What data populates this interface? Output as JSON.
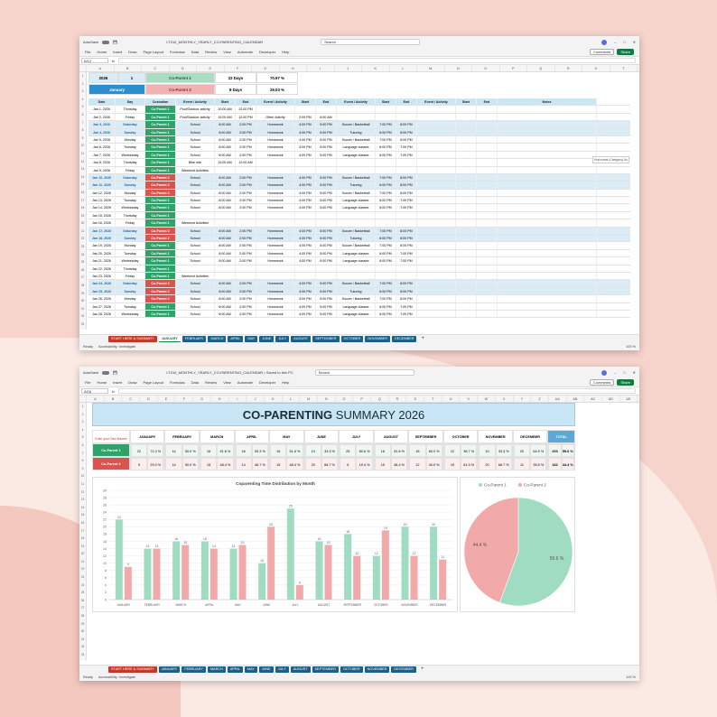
{
  "app": {
    "autosave": "AutoSave",
    "autosave_state": "Off",
    "file1": "LT010_MONTHLY_YEARLY_CO-PARENTING_CALENDAR",
    "file2": "LT010_MONTHLY_YEARLY_CO-PARENTING_CALENDAR • Saved to this PC",
    "search": "Search",
    "comments": "Comments",
    "share": "Share",
    "namebox1": "W12",
    "namebox2": "AG6",
    "fx": "fx",
    "ready": "Ready",
    "accessibility": "Accessibility: Investigate",
    "zoom": "100 %"
  },
  "ribbon": [
    "File",
    "Home",
    "Insert",
    "Draw",
    "Page Layout",
    "Formulas",
    "Data",
    "Review",
    "View",
    "Automate",
    "Developer",
    "Help"
  ],
  "columns1": [
    "A",
    "B",
    "C",
    "D",
    "E",
    "F",
    "G",
    "H",
    "I",
    "J",
    "K",
    "L",
    "M",
    "N",
    "O",
    "P",
    "Q",
    "R",
    "S",
    "T"
  ],
  "columns2": [
    "A",
    "B",
    "C",
    "D",
    "E",
    "F",
    "G",
    "H",
    "I",
    "J",
    "K",
    "L",
    "M",
    "N",
    "O",
    "P",
    "Q",
    "R",
    "S",
    "T",
    "U",
    "V",
    "W",
    "X",
    "Y",
    "Z",
    "AA",
    "AB",
    "AC",
    "AD",
    "AE"
  ],
  "tabs": [
    "START HERE & SUMMARY",
    "JANUARY",
    "FEBRUARY",
    "MARCH",
    "APRIL",
    "MAY",
    "JUNE",
    "JULY",
    "AUGUST",
    "SEPTEMBER",
    "OCTOBER",
    "NOVEMBER",
    "DECEMBER",
    "+"
  ],
  "calendar": {
    "year": "2026",
    "month_num": "1",
    "month": "January",
    "p1": "Co-Parent 1",
    "p2": "Co-Parent 2",
    "p1_days": "22 Days",
    "p1_pct": "70.97 %",
    "p2_days": "9 Days",
    "p2_pct": "29.03 %",
    "headers": [
      "Date",
      "Day",
      "Custodian",
      "Event / Activity",
      "Start",
      "End",
      "Event / Activity",
      "Start",
      "End",
      "Event / Activity",
      "Start",
      "End",
      "Event / Activity",
      "Start",
      "End",
      "Notes"
    ],
    "side_note": "Horizontal (Category) Ax",
    "rows": [
      [
        "Jan 1, 2026",
        "Thursday",
        "Co-Parent 1",
        "Pool/Outdoor activity",
        "10:00 AM",
        "12:00 PM",
        "",
        "",
        "",
        "",
        "",
        "",
        "",
        "",
        "",
        ""
      ],
      [
        "Jan 2, 2026",
        "Friday",
        "Co-Parent 1",
        "Pool/Outdoor activity",
        "10:00 AM",
        "12:00 PM",
        "Other Activity",
        "2:00 PM",
        "6:00 AM",
        "",
        "",
        "",
        "",
        "",
        "",
        ""
      ],
      [
        "Jan 3, 2026",
        "Saturday",
        "Co-Parent 1",
        "School",
        "8:00 AM",
        "2:00 PM",
        "Homework",
        "4:00 PM",
        "5:00 PM",
        "Soccer / Basketball",
        "7:00 PM",
        "8:00 PM",
        "",
        "",
        "",
        ""
      ],
      [
        "Jan 4, 2026",
        "Sunday",
        "Co-Parent 1",
        "School",
        "8:00 AM",
        "2:00 PM",
        "Homework",
        "4:00 PM",
        "5:00 PM",
        "Tutoring",
        "6:00 PM",
        "8:00 PM",
        "",
        "",
        "",
        ""
      ],
      [
        "Jan 5, 2026",
        "Monday",
        "Co-Parent 1",
        "School",
        "8:00 AM",
        "2:00 PM",
        "Homework",
        "4:00 PM",
        "5:00 PM",
        "Soccer / Basketball",
        "7:00 PM",
        "8:00 PM",
        "",
        "",
        "",
        ""
      ],
      [
        "Jan 6, 2026",
        "Tuesday",
        "Co-Parent 1",
        "School",
        "8:00 AM",
        "2:00 PM",
        "Homework",
        "4:00 PM",
        "5:00 PM",
        "Language classes",
        "6:00 PM",
        "7:00 PM",
        "",
        "",
        "",
        ""
      ],
      [
        "Jan 7, 2026",
        "Wednesday",
        "Co-Parent 1",
        "School",
        "8:00 AM",
        "2:00 PM",
        "Homework",
        "4:00 PM",
        "5:00 PM",
        "Language classes",
        "6:00 PM",
        "7:00 PM",
        "",
        "",
        "",
        ""
      ],
      [
        "Jan 8, 2026",
        "Thursday",
        "Co-Parent 1",
        "Bike ride",
        "10:00 AM",
        "12:00 AM",
        "",
        "",
        "",
        "",
        "",
        "",
        "",
        "",
        "",
        ""
      ],
      [
        "Jan 9, 2026",
        "Friday",
        "Co-Parent 1",
        "Weekend Activities",
        "",
        "",
        "",
        "",
        "",
        "",
        "",
        "",
        "",
        "",
        "",
        ""
      ],
      [
        "Jan 10, 2026",
        "Saturday",
        "Co-Parent 2",
        "School",
        "8:00 AM",
        "2:00 PM",
        "Homework",
        "4:00 PM",
        "5:00 PM",
        "Soccer / Basketball",
        "7:00 PM",
        "8:00 PM",
        "",
        "",
        "",
        ""
      ],
      [
        "Jan 11, 2026",
        "Sunday",
        "Co-Parent 2",
        "School",
        "8:00 AM",
        "2:00 PM",
        "Homework",
        "4:00 PM",
        "5:00 PM",
        "Tutoring",
        "6:00 PM",
        "8:00 PM",
        "",
        "",
        "",
        ""
      ],
      [
        "Jan 12, 2026",
        "Monday",
        "Co-Parent 2",
        "School",
        "8:00 AM",
        "2:00 PM",
        "Homework",
        "4:00 PM",
        "5:00 PM",
        "Soccer / Basketball",
        "7:00 PM",
        "8:00 PM",
        "",
        "",
        "",
        ""
      ],
      [
        "Jan 13, 2026",
        "Tuesday",
        "Co-Parent 1",
        "School",
        "8:00 AM",
        "2:00 PM",
        "Homework",
        "4:00 PM",
        "5:00 PM",
        "Language classes",
        "6:00 PM",
        "7:00 PM",
        "",
        "",
        "",
        ""
      ],
      [
        "Jan 14, 2026",
        "Wednesday",
        "Co-Parent 1",
        "School",
        "8:00 AM",
        "2:00 PM",
        "Homework",
        "4:00 PM",
        "5:00 PM",
        "Language classes",
        "6:00 PM",
        "7:00 PM",
        "",
        "",
        "",
        ""
      ],
      [
        "Jan 15, 2026",
        "Thursday",
        "Co-Parent 1",
        "",
        "",
        "",
        "",
        "",
        "",
        "",
        "",
        "",
        "",
        "",
        "",
        ""
      ],
      [
        "Jan 16, 2026",
        "Friday",
        "Co-Parent 1",
        "Weekend Activities",
        "",
        "",
        "",
        "",
        "",
        "",
        "",
        "",
        "",
        "",
        "",
        ""
      ],
      [
        "Jan 17, 2026",
        "Saturday",
        "Co-Parent 2",
        "School",
        "8:00 AM",
        "2:00 PM",
        "Homework",
        "4:00 PM",
        "5:00 PM",
        "Soccer / Basketball",
        "7:00 PM",
        "8:00 PM",
        "",
        "",
        "",
        ""
      ],
      [
        "Jan 18, 2026",
        "Sunday",
        "Co-Parent 2",
        "School",
        "8:00 AM",
        "2:00 PM",
        "Homework",
        "4:00 PM",
        "5:00 PM",
        "Tutoring",
        "6:00 PM",
        "8:00 PM",
        "",
        "",
        "",
        ""
      ],
      [
        "Jan 19, 2026",
        "Monday",
        "Co-Parent 1",
        "School",
        "8:00 AM",
        "2:00 PM",
        "Homework",
        "4:00 PM",
        "5:00 PM",
        "Soccer / Basketball",
        "7:00 PM",
        "8:00 PM",
        "",
        "",
        "",
        ""
      ],
      [
        "Jan 20, 2026",
        "Tuesday",
        "Co-Parent 1",
        "School",
        "8:00 AM",
        "2:00 PM",
        "Homework",
        "4:00 PM",
        "5:00 PM",
        "Language classes",
        "6:00 PM",
        "7:00 PM",
        "",
        "",
        "",
        ""
      ],
      [
        "Jan 21, 2026",
        "Wednesday",
        "Co-Parent 1",
        "School",
        "8:00 AM",
        "2:00 PM",
        "Homework",
        "4:00 PM",
        "5:00 PM",
        "Language classes",
        "6:00 PM",
        "7:00 PM",
        "",
        "",
        "",
        ""
      ],
      [
        "Jan 22, 2026",
        "Thursday",
        "Co-Parent 1",
        "",
        "",
        "",
        "",
        "",
        "",
        "",
        "",
        "",
        "",
        "",
        "",
        ""
      ],
      [
        "Jan 23, 2026",
        "Friday",
        "Co-Parent 1",
        "Weekend Activities",
        "",
        "",
        "",
        "",
        "",
        "",
        "",
        "",
        "",
        "",
        "",
        ""
      ],
      [
        "Jan 24, 2026",
        "Saturday",
        "Co-Parent 2",
        "School",
        "8:00 AM",
        "2:00 PM",
        "Homework",
        "4:00 PM",
        "5:00 PM",
        "Soccer / Basketball",
        "7:00 PM",
        "8:00 PM",
        "",
        "",
        "",
        ""
      ],
      [
        "Jan 25, 2026",
        "Sunday",
        "Co-Parent 2",
        "School",
        "8:00 AM",
        "2:00 PM",
        "Homework",
        "4:00 PM",
        "5:00 PM",
        "Tutoring",
        "6:00 PM",
        "8:00 PM",
        "",
        "",
        "",
        ""
      ],
      [
        "Jan 26, 2026",
        "Monday",
        "Co-Parent 2",
        "School",
        "8:00 AM",
        "2:00 PM",
        "Homework",
        "4:00 PM",
        "5:00 PM",
        "Soccer / Basketball",
        "7:00 PM",
        "8:00 PM",
        "",
        "",
        "",
        ""
      ],
      [
        "Jan 27, 2026",
        "Tuesday",
        "Co-Parent 1",
        "School",
        "8:00 AM",
        "2:00 PM",
        "Homework",
        "4:00 PM",
        "5:00 PM",
        "Language classes",
        "6:00 PM",
        "7:00 PM",
        "",
        "",
        "",
        ""
      ],
      [
        "Jan 28, 2026",
        "Wednesday",
        "Co-Parent 1",
        "School",
        "8:00 AM",
        "2:00 PM",
        "Homework",
        "4:00 PM",
        "5:00 PM",
        "Language classes",
        "6:00 PM",
        "7:00 PM",
        "",
        "",
        "",
        ""
      ]
    ]
  },
  "summary": {
    "title_bold": "CO-PARENTING",
    "title_rest": " SUMMARY 2026",
    "enter_note": "Enter your Own Names",
    "months": [
      "JANUARY",
      "FEBRUARY",
      "MARCH",
      "APRIL",
      "MAY",
      "JUNE",
      "JULY",
      "AUGUST",
      "SEPTEMBER",
      "OCTOBER",
      "NOVEMBER",
      "DECEMBER"
    ],
    "total_label": "TOTAL",
    "p1": {
      "name": "Co-Parent 1",
      "days": [
        "22",
        "14",
        "16",
        "16",
        "16",
        "10",
        "25",
        "16",
        "18",
        "12",
        "10",
        "20"
      ],
      "pct": [
        "71.0 %",
        "50.0 %",
        "51.6 %",
        "53.3 %",
        "51.6 %",
        "33.3 %",
        "80.6 %",
        "51.6 %",
        "60.0 %",
        "38.7 %",
        "33.3 %",
        "64.5 %"
      ],
      "total": "203",
      "total_pct": "55.6 %"
    },
    "p2": {
      "name": "Co-Parent 2",
      "days": [
        "9",
        "14",
        "15",
        "14",
        "15",
        "20",
        "6",
        "15",
        "12",
        "19",
        "20",
        "11"
      ],
      "pct": [
        "29.0 %",
        "50.0 %",
        "48.4 %",
        "46.7 %",
        "48.4 %",
        "66.7 %",
        "19.4 %",
        "48.4 %",
        "40.0 %",
        "61.3 %",
        "66.7 %",
        "35.5 %"
      ],
      "total": "162",
      "total_pct": "44.4 %"
    }
  },
  "chart_data": [
    {
      "type": "bar",
      "title": "Coparenting Time Distribution by Month",
      "categories": [
        "JANUARY",
        "FEBRUARY",
        "MARCH",
        "APRIL",
        "MAY",
        "JUNE",
        "JULY",
        "AUGUST",
        "SEPTEMBER",
        "OCTOBER",
        "NOVEMBER",
        "DECEMBER"
      ],
      "series": [
        {
          "name": "Co-Parent 1",
          "values": [
            22,
            14,
            16,
            16,
            14,
            10,
            25,
            16,
            18,
            12,
            20,
            20
          ],
          "color": "#9fdcc2"
        },
        {
          "name": "Co-Parent 2",
          "values": [
            9,
            14,
            15,
            14,
            15,
            20,
            4,
            15,
            12,
            19,
            12,
            11
          ],
          "color": "#f2a9a9"
        }
      ],
      "ylim": [
        0,
        30
      ],
      "yticks": [
        0,
        2,
        4,
        6,
        8,
        10,
        12,
        14,
        16,
        18,
        20,
        22,
        24,
        26,
        28,
        30
      ],
      "grid": true
    },
    {
      "type": "pie",
      "labels": [
        "Co-Parent 1",
        "Co-Parent 2"
      ],
      "values": [
        55.6,
        44.4
      ],
      "value_labels": [
        "55.6 %",
        "44.4 %"
      ],
      "colors": [
        "#9fdcc2",
        "#f2a9a9"
      ],
      "legend": "top"
    }
  ]
}
